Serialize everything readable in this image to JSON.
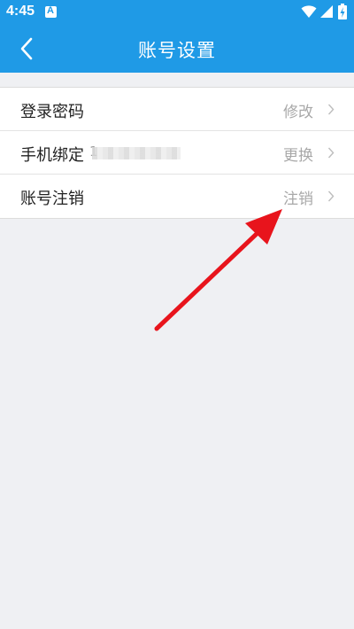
{
  "status_bar": {
    "time": "4:45",
    "notification_icon_letter": "A",
    "icons": [
      "wifi-icon",
      "signal-icon",
      "battery-charging-icon"
    ]
  },
  "header": {
    "title": "账号设置",
    "back_icon": "chevron-left-icon"
  },
  "settings": [
    {
      "label": "登录密码",
      "action": "修改"
    },
    {
      "label": "手机绑定",
      "action": "更换",
      "value_masked": "1"
    },
    {
      "label": "账号注销",
      "action": "注销"
    }
  ],
  "annotation": {
    "arrow_color": "#e8141c",
    "points_to": "注销"
  },
  "colors": {
    "primary": "#1f9ae6",
    "background": "#eff0f3",
    "action_text": "#a8a8a8"
  }
}
